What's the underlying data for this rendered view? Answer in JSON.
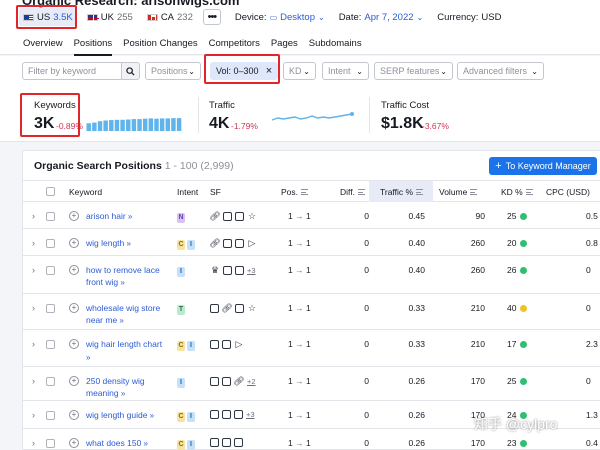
{
  "header": {
    "title": "Organic Research: arisonwigs.com",
    "databases": [
      {
        "flag": "us",
        "code": "US",
        "count": "3.5K",
        "active": true
      },
      {
        "flag": "uk",
        "code": "UK",
        "count": "255",
        "active": false
      },
      {
        "flag": "ca",
        "code": "CA",
        "count": "232",
        "active": false
      }
    ],
    "more_label": "•••",
    "device_label": "Device:",
    "device_value": "Desktop",
    "date_label": "Date:",
    "date_value": "Apr 7, 2022",
    "currency_label": "Currency:",
    "currency_value": "USD"
  },
  "tabs": [
    "Overview",
    "Positions",
    "Position Changes",
    "Competitors",
    "Pages",
    "Subdomains"
  ],
  "active_tab": "Positions",
  "filters": {
    "search_placeholder": "Filter by keyword",
    "positions": "Positions",
    "volume_chip": "Vol: 0–300",
    "kd": "KD",
    "intent": "Intent",
    "serp": "SERP features",
    "advanced": "Advanced filters"
  },
  "kpis": {
    "keywords": {
      "label": "Keywords",
      "value": "3K",
      "delta": "-0.89%"
    },
    "traffic": {
      "label": "Traffic",
      "value": "4K",
      "delta": "-1.79%"
    },
    "traffic_cost": {
      "label": "Traffic Cost",
      "value": "$1.8K",
      "delta": "-3.67%"
    },
    "keywords_bars": [
      0.55,
      0.6,
      0.7,
      0.75,
      0.78,
      0.8,
      0.8,
      0.82,
      0.85,
      0.85,
      0.88,
      0.9,
      0.88,
      0.9,
      0.9,
      0.92,
      0.92
    ],
    "traffic_trend": [
      0.6,
      0.5,
      0.55,
      0.5,
      0.45,
      0.55,
      0.5,
      0.4,
      0.5,
      0.45,
      0.5,
      0.45,
      0.4,
      0.35,
      0.3
    ]
  },
  "table": {
    "title": "Organic Search Positions",
    "range": "1 - 100 (2,999)",
    "manager_button": "To Keyword Manager",
    "columns": [
      "Keyword",
      "Intent",
      "SF",
      "Pos.",
      "Diff.",
      "Traffic %",
      "Volume",
      "KD %",
      "CPC (USD)"
    ],
    "rows": [
      {
        "keyword": "arison hair",
        "intents": [
          "N"
        ],
        "sf": [
          "link",
          "img",
          "img2",
          "star"
        ],
        "sf_more": "",
        "pos_from": "1",
        "pos_to": "1",
        "diff": "0",
        "traffic": "0.45",
        "volume": "90",
        "kd": "25",
        "kd_color": "#2fbf71",
        "cpc": "0.5"
      },
      {
        "keyword": "wig length",
        "intents": [
          "C",
          "I"
        ],
        "sf": [
          "link",
          "img",
          "chat",
          "video"
        ],
        "sf_more": "",
        "pos_from": "1",
        "pos_to": "1",
        "diff": "0",
        "traffic": "0.40",
        "volume": "260",
        "kd": "20",
        "kd_color": "#2fbf71",
        "cpc": "0.8"
      },
      {
        "keyword": "how to remove lace front wig",
        "intents": [
          "I"
        ],
        "sf": [
          "crown",
          "chat",
          "img2"
        ],
        "sf_more": "+3",
        "pos_from": "1",
        "pos_to": "1",
        "diff": "0",
        "traffic": "0.40",
        "volume": "260",
        "kd": "26",
        "kd_color": "#2fbf71",
        "cpc": "0"
      },
      {
        "keyword": "wholesale wig store near me",
        "intents": [
          "T"
        ],
        "sf": [
          "chat",
          "link",
          "img2",
          "star"
        ],
        "sf_more": "",
        "pos_from": "1",
        "pos_to": "1",
        "diff": "0",
        "traffic": "0.33",
        "volume": "210",
        "kd": "40",
        "kd_color": "#f4c21c",
        "cpc": "0"
      },
      {
        "keyword": "wig hair length chart",
        "intents": [
          "C",
          "I"
        ],
        "sf": [
          "chat",
          "img",
          "video"
        ],
        "sf_more": "",
        "pos_from": "1",
        "pos_to": "1",
        "diff": "0",
        "traffic": "0.33",
        "volume": "210",
        "kd": "17",
        "kd_color": "#2fbf71",
        "cpc": "2.3"
      },
      {
        "keyword": "250 density wig meaning",
        "intents": [
          "I"
        ],
        "sf": [
          "img",
          "chat",
          "link"
        ],
        "sf_more": "+2",
        "pos_from": "1",
        "pos_to": "1",
        "diff": "0",
        "traffic": "0.26",
        "volume": "170",
        "kd": "25",
        "kd_color": "#2fbf71",
        "cpc": "0"
      },
      {
        "keyword": "wig length guide",
        "intents": [
          "C",
          "I"
        ],
        "sf": [
          "img",
          "chat",
          "img2"
        ],
        "sf_more": "+3",
        "pos_from": "1",
        "pos_to": "1",
        "diff": "0",
        "traffic": "0.26",
        "volume": "170",
        "kd": "24",
        "kd_color": "#2fbf71",
        "cpc": "1.3"
      },
      {
        "keyword": "what does 150",
        "intents": [
          "C",
          "I"
        ],
        "sf": [
          "chat",
          "img",
          "img2"
        ],
        "sf_more": "",
        "pos_from": "1",
        "pos_to": "1",
        "diff": "0",
        "traffic": "0.26",
        "volume": "170",
        "kd": "23",
        "kd_color": "#2fbf71",
        "cpc": "0.4"
      }
    ]
  },
  "watermark": "知乎 @cylpro",
  "colors": {
    "link": "#2b5bd7",
    "highlight_red": "#e0262a",
    "negative": "#d1335a",
    "primary": "#1a73e8",
    "bar": "#5fb4ec"
  }
}
